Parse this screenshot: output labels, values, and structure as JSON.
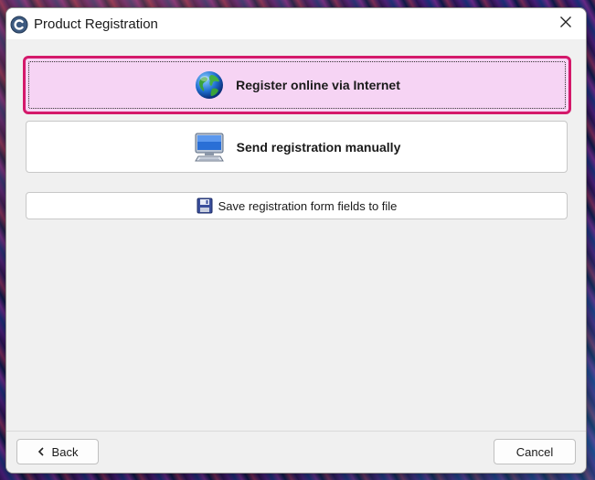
{
  "window": {
    "title": "Product Registration",
    "app_icon": "c-logo-icon",
    "close_icon": "close-icon"
  },
  "buttons": {
    "register_online": {
      "label": "Register online via Internet",
      "icon": "globe-icon",
      "focused": true
    },
    "send_manually": {
      "label": "Send registration manually",
      "icon": "computer-icon"
    },
    "save_to_file": {
      "label": "Save registration form fields to file",
      "icon": "floppy-disk-icon"
    }
  },
  "footer": {
    "back_label": "Back",
    "back_icon": "chevron-left-icon",
    "cancel_label": "Cancel"
  },
  "colors": {
    "focus_border": "#d4196a",
    "focus_fill": "#f6d4f4",
    "dialog_bg": "#f0f0f0"
  }
}
